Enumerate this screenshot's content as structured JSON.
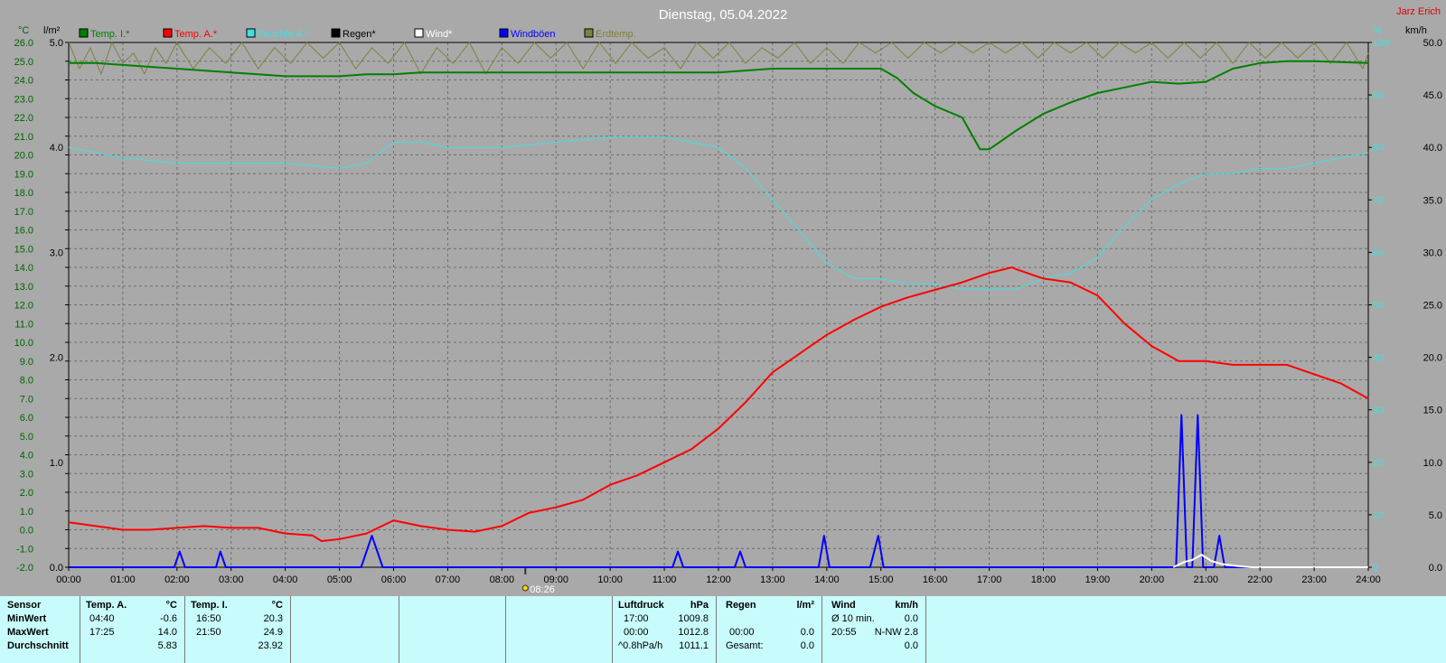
{
  "header": {
    "title": "Dienstag, 05.04.2022",
    "author": "Jarz Erich"
  },
  "axes": {
    "left_units": [
      "°C",
      "l/m²"
    ],
    "right_units": [
      "%",
      "km/h"
    ],
    "temp_ticks": [
      "26.0",
      "25.0",
      "24.0",
      "23.0",
      "22.0",
      "21.0",
      "20.0",
      "19.0",
      "18.0",
      "17.0",
      "16.0",
      "15.0",
      "14.0",
      "13.0",
      "12.0",
      "11.0",
      "10.0",
      "9.0",
      "8.0",
      "7.0",
      "6.0",
      "5.0",
      "4.0",
      "3.0",
      "2.0",
      "1.0",
      "0.0",
      "-1.0",
      "-2.0"
    ],
    "rain_ticks": [
      "5.0",
      "4.0",
      "3.0",
      "2.0",
      "1.0",
      "0.0"
    ],
    "hum_ticks": [
      "100",
      "90",
      "80",
      "70",
      "60",
      "50",
      "40",
      "30",
      "20",
      "10",
      "0"
    ],
    "wind_ticks": [
      "50.0",
      "45.0",
      "40.0",
      "35.0",
      "30.0",
      "25.0",
      "20.0",
      "15.0",
      "10.0",
      "5.0",
      "0.0"
    ],
    "time_ticks": [
      "00:00",
      "01:00",
      "02:00",
      "03:00",
      "04:00",
      "05:00",
      "06:00",
      "07:00",
      "08:00",
      "09:00",
      "10:00",
      "11:00",
      "12:00",
      "13:00",
      "14:00",
      "15:00",
      "16:00",
      "17:00",
      "18:00",
      "19:00",
      "20:00",
      "21:00",
      "22:00",
      "23:00",
      "24:00"
    ],
    "marker_label": "08:26"
  },
  "legend": [
    {
      "label": "Temp. I.*",
      "color": "#008000"
    },
    {
      "label": "Temp. A.*",
      "color": "#ff0000"
    },
    {
      "label": "Feuchte A.*",
      "color": "#40e0e0"
    },
    {
      "label": "Regen*",
      "color": "#000000"
    },
    {
      "label": "Wind*",
      "color": "#ffffff"
    },
    {
      "label": "Windböen",
      "color": "#0000ff"
    },
    {
      "label": "Erdtemp.",
      "color": "#808040"
    }
  ],
  "chart_data": {
    "type": "line",
    "x_unit": "hours",
    "temp_range": [
      -2,
      26
    ],
    "rain_range": [
      0,
      5
    ],
    "hum_range": [
      0,
      100
    ],
    "wind_range": [
      0,
      50
    ],
    "series": [
      {
        "name": "Temp. I.*",
        "axis": "temp",
        "color": "#008000",
        "points": [
          [
            0,
            24.9
          ],
          [
            0.5,
            24.9
          ],
          [
            1,
            24.8
          ],
          [
            1.5,
            24.7
          ],
          [
            2,
            24.6
          ],
          [
            2.5,
            24.5
          ],
          [
            3,
            24.4
          ],
          [
            3.5,
            24.3
          ],
          [
            4,
            24.2
          ],
          [
            4.5,
            24.2
          ],
          [
            5,
            24.2
          ],
          [
            5.5,
            24.3
          ],
          [
            6,
            24.3
          ],
          [
            6.5,
            24.4
          ],
          [
            7,
            24.4
          ],
          [
            8,
            24.4
          ],
          [
            9,
            24.4
          ],
          [
            10,
            24.4
          ],
          [
            11,
            24.4
          ],
          [
            11.5,
            24.4
          ],
          [
            12,
            24.4
          ],
          [
            13,
            24.6
          ],
          [
            14,
            24.6
          ],
          [
            14.5,
            24.6
          ],
          [
            15,
            24.6
          ],
          [
            15.3,
            24.1
          ],
          [
            15.6,
            23.3
          ],
          [
            16,
            22.6
          ],
          [
            16.5,
            22.0
          ],
          [
            16.83,
            20.3
          ],
          [
            17,
            20.3
          ],
          [
            17.5,
            21.3
          ],
          [
            18,
            22.2
          ],
          [
            18.5,
            22.8
          ],
          [
            19,
            23.3
          ],
          [
            19.5,
            23.6
          ],
          [
            20,
            23.9
          ],
          [
            20.5,
            23.8
          ],
          [
            21,
            23.9
          ],
          [
            21.5,
            24.6
          ],
          [
            22,
            24.9
          ],
          [
            22.5,
            25.0
          ],
          [
            23,
            25.0
          ],
          [
            24,
            24.9
          ]
        ]
      },
      {
        "name": "Temp. A.*",
        "axis": "temp",
        "color": "#ff0000",
        "points": [
          [
            0,
            0.4
          ],
          [
            0.5,
            0.2
          ],
          [
            1,
            0.0
          ],
          [
            1.5,
            0.0
          ],
          [
            2,
            0.1
          ],
          [
            2.5,
            0.2
          ],
          [
            3,
            0.1
          ],
          [
            3.5,
            0.1
          ],
          [
            4,
            -0.2
          ],
          [
            4.5,
            -0.3
          ],
          [
            4.67,
            -0.6
          ],
          [
            5,
            -0.5
          ],
          [
            5.5,
            -0.2
          ],
          [
            6,
            0.5
          ],
          [
            6.5,
            0.2
          ],
          [
            7,
            0.0
          ],
          [
            7.5,
            -0.1
          ],
          [
            8,
            0.2
          ],
          [
            8.5,
            0.9
          ],
          [
            9,
            1.2
          ],
          [
            9.5,
            1.6
          ],
          [
            10,
            2.4
          ],
          [
            10.5,
            2.9
          ],
          [
            11,
            3.6
          ],
          [
            11.5,
            4.3
          ],
          [
            12,
            5.4
          ],
          [
            12.5,
            6.8
          ],
          [
            13,
            8.4
          ],
          [
            13.5,
            9.4
          ],
          [
            14,
            10.4
          ],
          [
            14.5,
            11.2
          ],
          [
            15,
            11.9
          ],
          [
            15.5,
            12.4
          ],
          [
            16,
            12.8
          ],
          [
            16.5,
            13.2
          ],
          [
            17,
            13.7
          ],
          [
            17.42,
            14.0
          ],
          [
            17.5,
            13.9
          ],
          [
            18,
            13.4
          ],
          [
            18.5,
            13.2
          ],
          [
            19,
            12.5
          ],
          [
            19.5,
            11.0
          ],
          [
            20,
            9.8
          ],
          [
            20.5,
            9.0
          ],
          [
            21,
            9.0
          ],
          [
            21.5,
            8.8
          ],
          [
            22,
            8.8
          ],
          [
            22.5,
            8.8
          ],
          [
            23,
            8.3
          ],
          [
            23.5,
            7.8
          ],
          [
            24,
            7.0
          ]
        ]
      },
      {
        "name": "Feuchte A.*",
        "axis": "hum",
        "color": "#40e0e0",
        "points": [
          [
            0,
            80
          ],
          [
            1,
            78
          ],
          [
            2,
            77
          ],
          [
            3,
            77
          ],
          [
            4,
            77
          ],
          [
            5,
            76
          ],
          [
            5.5,
            77
          ],
          [
            6,
            81
          ],
          [
            6.5,
            81
          ],
          [
            7,
            80
          ],
          [
            8,
            80
          ],
          [
            9,
            81
          ],
          [
            10,
            82
          ],
          [
            11,
            82
          ],
          [
            12,
            80
          ],
          [
            12.5,
            76
          ],
          [
            13,
            70
          ],
          [
            13.5,
            64
          ],
          [
            14,
            58
          ],
          [
            14.5,
            55
          ],
          [
            15,
            55
          ],
          [
            15.5,
            54
          ],
          [
            16,
            54
          ],
          [
            16.5,
            53
          ],
          [
            17,
            53
          ],
          [
            17.5,
            53
          ],
          [
            18,
            55
          ],
          [
            18.5,
            56
          ],
          [
            19,
            59
          ],
          [
            19.5,
            65
          ],
          [
            20,
            70
          ],
          [
            20.5,
            73
          ],
          [
            21,
            75
          ],
          [
            21.5,
            75
          ],
          [
            22,
            76
          ],
          [
            22.5,
            76
          ],
          [
            23,
            77
          ],
          [
            24,
            79
          ]
        ]
      },
      {
        "name": "Windböen",
        "axis": "wind",
        "color": "#0000ff",
        "points": [
          [
            0,
            0
          ],
          [
            1.95,
            0
          ],
          [
            2.05,
            1.5
          ],
          [
            2.15,
            0
          ],
          [
            2.72,
            0
          ],
          [
            2.8,
            1.5
          ],
          [
            2.9,
            0
          ],
          [
            5.4,
            0
          ],
          [
            5.6,
            3.0
          ],
          [
            5.8,
            0
          ],
          [
            11.15,
            0
          ],
          [
            11.25,
            1.5
          ],
          [
            11.35,
            0
          ],
          [
            12.3,
            0
          ],
          [
            12.4,
            1.5
          ],
          [
            12.5,
            0
          ],
          [
            13.85,
            0
          ],
          [
            13.95,
            3.0
          ],
          [
            14.05,
            0
          ],
          [
            14.8,
            0
          ],
          [
            14.95,
            3.0
          ],
          [
            15.05,
            0
          ],
          [
            20.45,
            0
          ],
          [
            20.55,
            14.5
          ],
          [
            20.65,
            0
          ],
          [
            20.75,
            0
          ],
          [
            20.85,
            14.5
          ],
          [
            20.95,
            0
          ],
          [
            21.15,
            0
          ],
          [
            21.25,
            3.0
          ],
          [
            21.35,
            0
          ],
          [
            24,
            0
          ]
        ]
      },
      {
        "name": "Wind*",
        "axis": "wind",
        "color": "#ffffff",
        "points": [
          [
            20.4,
            0
          ],
          [
            20.6,
            0.5
          ],
          [
            20.75,
            0.7
          ],
          [
            20.92,
            1.2
          ],
          [
            21.1,
            0.6
          ],
          [
            21.3,
            0.3
          ],
          [
            21.6,
            0.1
          ],
          [
            21.85,
            0
          ],
          [
            24,
            0
          ]
        ]
      },
      {
        "name": "Erdtemp.",
        "axis": "hum",
        "color": "#808040",
        "points": [
          [
            0,
            100
          ],
          [
            0.2,
            95
          ],
          [
            0.4,
            99
          ],
          [
            0.6,
            94
          ],
          [
            0.8,
            100
          ],
          [
            1.0,
            96
          ],
          [
            1.2,
            98
          ],
          [
            1.4,
            94
          ],
          [
            1.6,
            99
          ],
          [
            1.8,
            96
          ],
          [
            2.0,
            100
          ],
          [
            2.3,
            95
          ],
          [
            2.6,
            99
          ],
          [
            2.9,
            96
          ],
          [
            3.2,
            100
          ],
          [
            3.5,
            95
          ],
          [
            3.8,
            99
          ],
          [
            4.1,
            96
          ],
          [
            4.4,
            100
          ],
          [
            4.7,
            97
          ],
          [
            5.0,
            100
          ],
          [
            5.3,
            95
          ],
          [
            5.6,
            99
          ],
          [
            5.9,
            96
          ],
          [
            6.2,
            100
          ],
          [
            6.5,
            94
          ],
          [
            6.8,
            99
          ],
          [
            7.1,
            96
          ],
          [
            7.4,
            100
          ],
          [
            7.7,
            94
          ],
          [
            8.0,
            99
          ],
          [
            8.3,
            96
          ],
          [
            8.6,
            100
          ],
          [
            8.9,
            97
          ],
          [
            9.2,
            100
          ],
          [
            9.5,
            95
          ],
          [
            9.8,
            100
          ],
          [
            10.1,
            96
          ],
          [
            10.4,
            100
          ],
          [
            10.7,
            97
          ],
          [
            11.0,
            99
          ],
          [
            11.3,
            95
          ],
          [
            11.6,
            100
          ],
          [
            11.9,
            97
          ],
          [
            12.2,
            100
          ],
          [
            12.5,
            96
          ],
          [
            12.8,
            99
          ],
          [
            13.1,
            97
          ],
          [
            13.4,
            100
          ],
          [
            13.7,
            96
          ],
          [
            14.0,
            99
          ],
          [
            14.3,
            96
          ],
          [
            14.6,
            100
          ],
          [
            14.9,
            98
          ],
          [
            15.2,
            100
          ],
          [
            15.5,
            97
          ],
          [
            15.8,
            100
          ],
          [
            16.1,
            98
          ],
          [
            16.4,
            100
          ],
          [
            16.7,
            98
          ],
          [
            17.0,
            100
          ],
          [
            17.3,
            98
          ],
          [
            17.6,
            100
          ],
          [
            17.9,
            97
          ],
          [
            18.2,
            100
          ],
          [
            18.5,
            98
          ],
          [
            18.8,
            100
          ],
          [
            19.1,
            97
          ],
          [
            19.4,
            100
          ],
          [
            19.7,
            98
          ],
          [
            20.0,
            100
          ],
          [
            20.3,
            97
          ],
          [
            20.6,
            100
          ],
          [
            20.9,
            97
          ],
          [
            21.2,
            100
          ],
          [
            21.5,
            96
          ],
          [
            21.8,
            100
          ],
          [
            22.1,
            97
          ],
          [
            22.4,
            100
          ],
          [
            22.7,
            97
          ],
          [
            23.0,
            100
          ],
          [
            23.3,
            96
          ],
          [
            23.6,
            100
          ],
          [
            23.9,
            95
          ],
          [
            24,
            98
          ]
        ]
      }
    ]
  },
  "stats": {
    "sensor": {
      "header": "Sensor",
      "rows": [
        "MinWert",
        "MaxWert",
        "Durchschnitt"
      ]
    },
    "temp_a": {
      "header": "Temp. A.",
      "unit": "°C",
      "rows": [
        [
          "04:40",
          "-0.6"
        ],
        [
          "17:25",
          "14.0"
        ],
        [
          "",
          "5.83"
        ]
      ]
    },
    "temp_i": {
      "header": "Temp. I.",
      "unit": "°C",
      "rows": [
        [
          "16:50",
          "20.3"
        ],
        [
          "21:50",
          "24.9"
        ],
        [
          "",
          "23.92"
        ]
      ]
    },
    "pressure": {
      "header": "Luftdruck",
      "unit": "hPa",
      "rows": [
        [
          "17:00",
          "1009.8"
        ],
        [
          "00:00",
          "1012.8"
        ],
        [
          "^0.8hPa/h",
          "1011.1"
        ]
      ]
    },
    "rain": {
      "header": "Regen",
      "unit": "l/m²",
      "rows": [
        [
          "",
          ""
        ],
        [
          "00:00",
          "0.0"
        ],
        [
          "Gesamt:",
          "0.0"
        ]
      ]
    },
    "wind": {
      "header": "Wind",
      "unit": "km/h",
      "rows": [
        [
          "Ø 10 min.",
          "0.0"
        ],
        [
          "20:55",
          "N-NW 2.8"
        ],
        [
          "",
          "0.0"
        ]
      ]
    }
  }
}
